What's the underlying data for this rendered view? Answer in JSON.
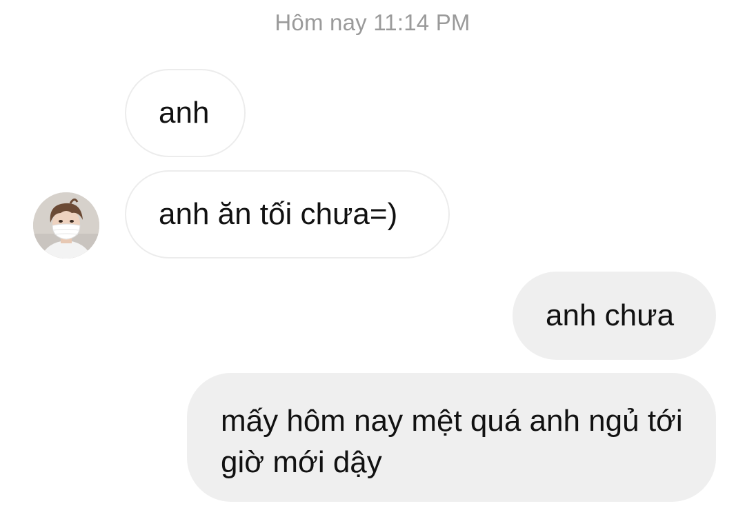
{
  "chat": {
    "timestamp": "Hôm nay 11:14 PM",
    "messages": [
      {
        "sender": "them",
        "text": "anh"
      },
      {
        "sender": "them",
        "text": "anh ăn tối chưa=)"
      },
      {
        "sender": "me",
        "text": "anh chưa"
      },
      {
        "sender": "me",
        "text": "mấy hôm nay mệt quá anh ngủ tới giờ mới dậy"
      }
    ],
    "avatar": {
      "icon": "profile-photo-masked-person"
    }
  },
  "colors": {
    "incoming_bubble": "#ffffff",
    "incoming_border": "#ececec",
    "outgoing_bubble": "#efefef",
    "timestamp_text": "#9a9a9a",
    "message_text": "#111111"
  }
}
